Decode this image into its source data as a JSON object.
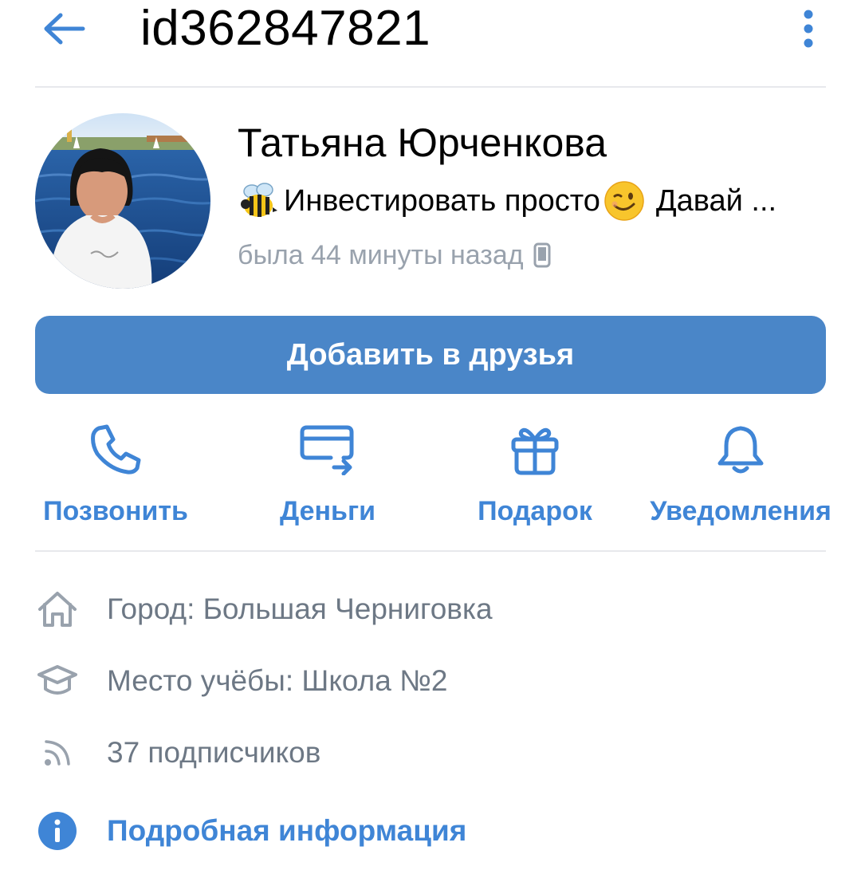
{
  "header": {
    "title": "id362847821",
    "back_icon": "arrow-left-icon",
    "more_icon": "more-vertical-icon"
  },
  "profile": {
    "name": "Татьяна Юрченкова",
    "status_text_before": "Инвестировать просто",
    "status_text_after": "Давай ...",
    "status_emoji_before": "bee-emoji",
    "status_emoji_after": "winking-face-emoji",
    "last_seen": "была 44 минуты назад",
    "last_seen_icon": "mobile-phone-icon"
  },
  "add_friend": {
    "label": "Добавить в друзья"
  },
  "actions": [
    {
      "label": "Позвонить",
      "icon": "phone-icon"
    },
    {
      "label": "Деньги",
      "icon": "money-transfer-icon"
    },
    {
      "label": "Подарок",
      "icon": "gift-icon"
    },
    {
      "label": "Уведомления",
      "icon": "bell-icon"
    }
  ],
  "info": [
    {
      "text": "Город: Большая Черниговка",
      "icon": "home-icon"
    },
    {
      "text": "Место учёбы: Школа №2",
      "icon": "education-icon"
    },
    {
      "text": "37 подписчиков",
      "icon": "rss-icon"
    }
  ],
  "details_link": {
    "label": "Подробная информация",
    "icon": "info-icon"
  },
  "colors": {
    "accent": "#4a86c8",
    "link": "#3f85d6",
    "secondary_text": "#6d7885",
    "muted_text": "#99a2ad",
    "divider": "#e7e8ec"
  }
}
